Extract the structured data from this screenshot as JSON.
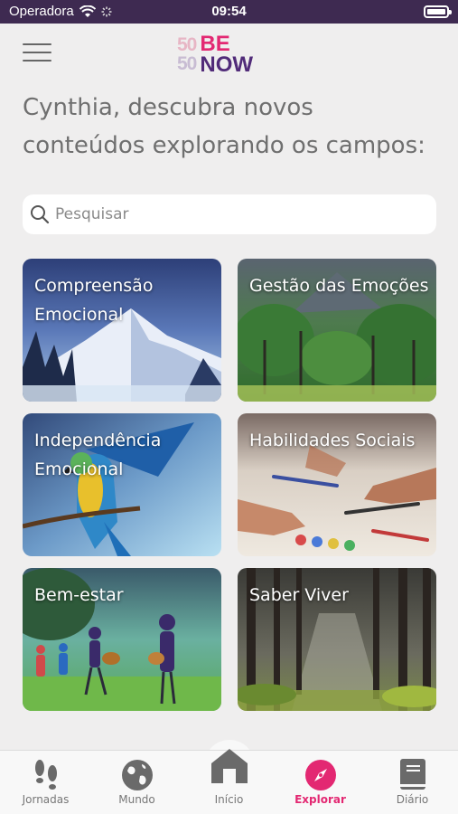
{
  "status_bar": {
    "carrier": "Operadora",
    "time": "09:54"
  },
  "header": {
    "logo_fifty_top": "50",
    "logo_fifty_bottom": "50",
    "logo_be": "BE",
    "logo_now": "NOW"
  },
  "heading": "Cynthia, descubra novos conteúdos explorando os campos:",
  "search": {
    "placeholder": "Pesquisar",
    "value": ""
  },
  "cards": [
    {
      "title": "Compreensão Emocional"
    },
    {
      "title": "Gestão das Emoções"
    },
    {
      "title": "Independência Emocional"
    },
    {
      "title": "Habilidades Sociais"
    },
    {
      "title": "Bem-estar"
    },
    {
      "title": "Saber Viver"
    }
  ],
  "tabs": [
    {
      "label": "Jornadas",
      "icon": "footprints-icon"
    },
    {
      "label": "Mundo",
      "icon": "globe-icon"
    },
    {
      "label": "Início",
      "icon": "home-icon"
    },
    {
      "label": "Explorar",
      "icon": "compass-icon",
      "active": true
    },
    {
      "label": "Diário",
      "icon": "book-icon"
    }
  ],
  "colors": {
    "accent": "#e32872",
    "brand_purple": "#512b79",
    "status_bar": "#3e2a51"
  }
}
